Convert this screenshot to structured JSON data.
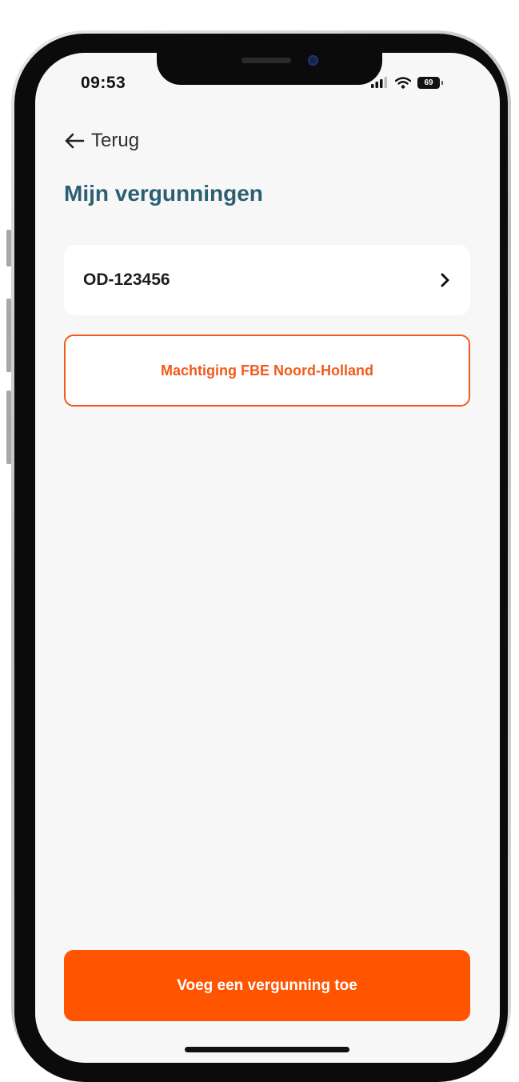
{
  "status_bar": {
    "time": "09:53",
    "battery": "69",
    "icons": [
      "signal-icon",
      "wifi-icon",
      "battery-icon"
    ]
  },
  "header": {
    "back_label": "Terug",
    "back_icon": "arrow-left-icon"
  },
  "page": {
    "title": "Mijn vergunningen"
  },
  "permits": [
    {
      "id": "OD-123456",
      "icon": "chevron-right-icon"
    }
  ],
  "authorization_button": {
    "label": "Machtiging FBE Noord-Holland"
  },
  "add_button": {
    "label": "Voeg een vergunning toe"
  },
  "colors": {
    "accent": "#FF5500",
    "accent_outline": "#F25A1C",
    "title": "#2D5F73",
    "background": "#F7F7F7",
    "card": "#FFFFFF"
  }
}
